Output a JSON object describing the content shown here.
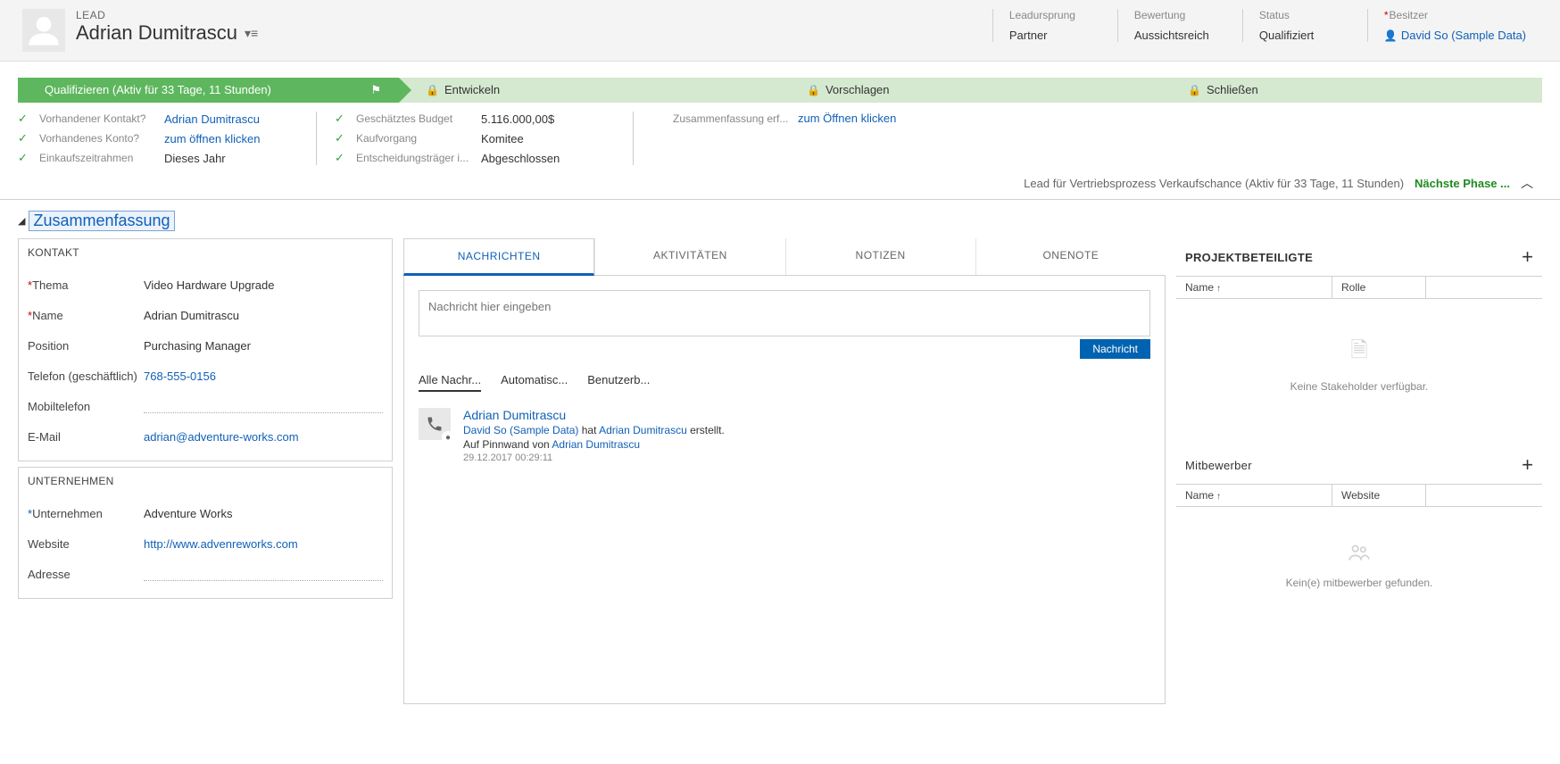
{
  "header": {
    "entity_label": "LEAD",
    "record_name": "Adrian Dumitrascu",
    "fields": [
      {
        "label": "Leadursprung",
        "value": "Partner",
        "link": false
      },
      {
        "label": "Bewertung",
        "value": "Aussichtsreich",
        "link": false
      },
      {
        "label": "Status",
        "value": "Qualifiziert",
        "link": false
      },
      {
        "label": "Besitzer",
        "value": "David So (Sample Data)",
        "link": true,
        "required": true,
        "owner_icon": true
      }
    ]
  },
  "process": {
    "stages": [
      {
        "label": "Qualifizieren (Aktiv für 33 Tage, 11 Stunden)",
        "active": true,
        "locked": false
      },
      {
        "label": "Entwickeln",
        "active": false,
        "locked": true
      },
      {
        "label": "Vorschlagen",
        "active": false,
        "locked": true
      },
      {
        "label": "Schließen",
        "active": false,
        "locked": true
      }
    ],
    "details": {
      "col1": [
        {
          "label": "Vorhandener Kontakt?",
          "value": "Adrian Dumitrascu",
          "link": true
        },
        {
          "label": "Vorhandenes Konto?",
          "value": "zum öffnen klicken",
          "link": true
        },
        {
          "label": "Einkaufszeitrahmen",
          "value": "Dieses Jahr",
          "link": false
        }
      ],
      "col2": [
        {
          "label": "Geschätztes Budget",
          "value": "5.116.000,00$",
          "link": false
        },
        {
          "label": "Kaufvorgang",
          "value": "Komitee",
          "link": false
        },
        {
          "label": "Entscheidungsträger i...",
          "value": "Abgeschlossen",
          "link": false
        }
      ],
      "col3": [
        {
          "label": "Zusammenfassung erf...",
          "value": "zum Öffnen klicken",
          "link": true,
          "nocheck": true
        }
      ]
    },
    "footer_text": "Lead für Vertriebsprozess Verkaufschance (Aktiv für 33 Tage, 11 Stunden)",
    "next_phase": "Nächste Phase ..."
  },
  "section_title": "Zusammenfassung",
  "contact_panel": {
    "title": "KONTAKT",
    "rows": [
      {
        "label": "Thema",
        "value": "Video Hardware Upgrade",
        "required": true
      },
      {
        "label": "Name",
        "value": "Adrian Dumitrascu",
        "required": true
      },
      {
        "label": "Position",
        "value": "Purchasing Manager"
      },
      {
        "label": "Telefon (geschäftlich)",
        "value": "768-555-0156",
        "link": true
      },
      {
        "label": "Mobiltelefon",
        "value": "",
        "empty": true
      },
      {
        "label": "E-Mail",
        "value": "adrian@adventure-works.com",
        "link": true
      }
    ]
  },
  "company_panel": {
    "title": "UNTERNEHMEN",
    "rows": [
      {
        "label": "Unternehmen",
        "value": "Adventure Works",
        "required_blue": true
      },
      {
        "label": "Website",
        "value": "http://www.advenreworks.com",
        "link": true
      },
      {
        "label": "Adresse",
        "value": "",
        "empty": true
      }
    ]
  },
  "mid": {
    "tabs": [
      "NACHRICHTEN",
      "AKTIVITÄTEN",
      "NOTIZEN",
      "ONENOTE"
    ],
    "placeholder": "Nachricht hier eingeben",
    "send_button": "Nachricht",
    "filter_tabs": [
      "Alle Nachr...",
      "Automatisc...",
      "Benutzerb..."
    ],
    "post": {
      "title": "Adrian Dumitrascu",
      "line1_a": "David So (Sample Data)",
      "line1_b": " hat ",
      "line1_c": "Adrian Dumitrascu",
      "line1_d": " erstellt.",
      "line2_a": "Auf Pinnwand von ",
      "line2_b": "Adrian Dumitrascu",
      "date": "29.12.2017 00:29:11"
    }
  },
  "stakeholders": {
    "title": "PROJEKTBETEILIGTE",
    "cols": [
      "Name",
      "Rolle"
    ],
    "empty_text": "Keine Stakeholder verfügbar."
  },
  "competitors": {
    "title": "Mitbewerber",
    "cols": [
      "Name",
      "Website"
    ],
    "empty_text": "Kein(e) mitbewerber gefunden."
  }
}
